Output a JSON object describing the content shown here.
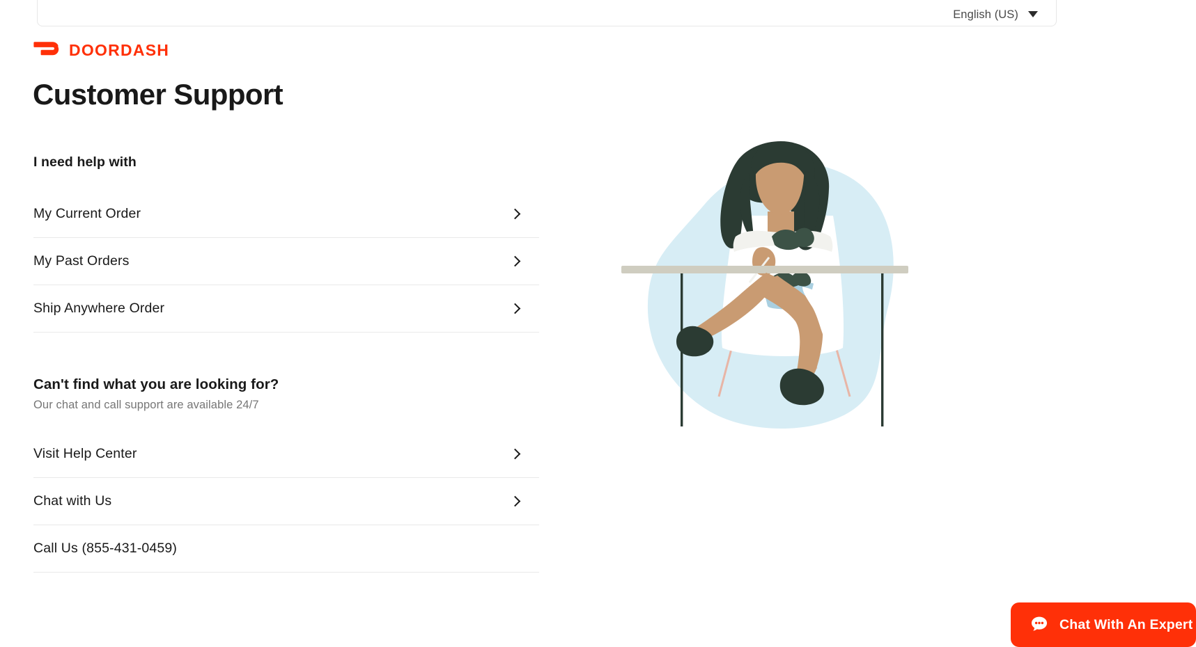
{
  "brand": {
    "logo_icon": "doordash-swoosh-icon",
    "wordmark": "DOORDASH",
    "color": "#FF3008"
  },
  "language_bar": {
    "selected_language": "English (US)",
    "caret_icon": "chevron-down-icon"
  },
  "page_title": "Customer Support",
  "help_section": {
    "heading": "I need help with",
    "items": [
      {
        "label": "My Current Order",
        "chevron": "chevron-right-icon",
        "has_chevron": true
      },
      {
        "label": "My Past Orders",
        "chevron": "chevron-right-icon",
        "has_chevron": true
      },
      {
        "label": "Ship Anywhere Order",
        "chevron": "chevron-right-icon",
        "has_chevron": true
      }
    ]
  },
  "support_section": {
    "heading": "Can't find what you are looking for?",
    "subtext": "Our chat and call support are available 24/7",
    "items": [
      {
        "label": "Visit Help Center",
        "chevron": "chevron-right-icon",
        "has_chevron": true
      },
      {
        "label": "Chat with Us",
        "chevron": "chevron-right-icon",
        "has_chevron": true
      },
      {
        "label": "Call Us (855-431-0459)",
        "chevron": "",
        "has_chevron": false
      }
    ]
  },
  "illustration": {
    "name": "woman-eating-salad-at-table-illustration",
    "blob_color": "#d7edf5",
    "hair_color": "#2b3b33",
    "skin_color": "#c99b72",
    "dress_color": "#ffffff",
    "table_color": "#cfcdc0",
    "bowl_color": "#a9cfe0"
  },
  "chat_widget": {
    "label": "Chat With An Expert",
    "icon": "chat-bubble-icon",
    "background_color": "#FF3008",
    "text_color": "#FFFFFF"
  }
}
